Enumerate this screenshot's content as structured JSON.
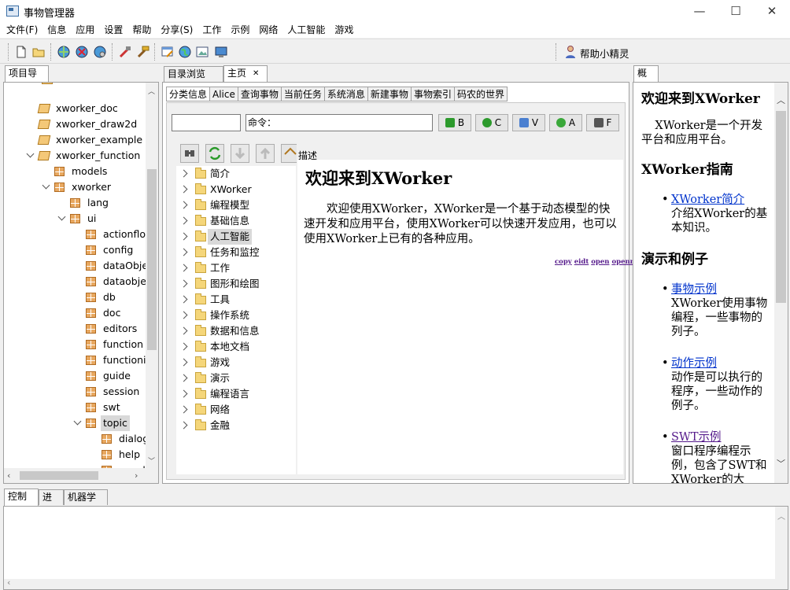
{
  "window": {
    "title": "事物管理器",
    "minimize": "—",
    "maximize": "☐",
    "close": "✕"
  },
  "menu": [
    "文件(F)",
    "信息",
    "应用",
    "设置",
    "帮助",
    "分享(S)",
    "工作",
    "示例",
    "网络",
    "人工智能",
    "游戏"
  ],
  "toolbar": {
    "helper_label": "帮助小精灵"
  },
  "left_panel": {
    "tab": "项目导航",
    "tree": [
      {
        "label": "xworker_doc",
        "type": "pkgopen"
      },
      {
        "label": "xworker_draw2d",
        "type": "pkgopen"
      },
      {
        "label": "xworker_example",
        "type": "pkgopen"
      },
      {
        "label": "xworker_function",
        "type": "pkgopen"
      },
      {
        "label": "models",
        "type": "pkg"
      },
      {
        "label": "xworker",
        "type": "pkg"
      },
      {
        "label": "lang",
        "type": "pkg"
      },
      {
        "label": "ui",
        "type": "pkg"
      },
      {
        "label": "actionflow",
        "type": "pkg"
      },
      {
        "label": "config",
        "type": "pkg"
      },
      {
        "label": "dataObje",
        "type": "pkg"
      },
      {
        "label": "dataobjec",
        "type": "pkg"
      },
      {
        "label": "db",
        "type": "pkg"
      },
      {
        "label": "doc",
        "type": "pkg"
      },
      {
        "label": "editors",
        "type": "pkg"
      },
      {
        "label": "function",
        "type": "pkg"
      },
      {
        "label": "functionin",
        "type": "pkg"
      },
      {
        "label": "guide",
        "type": "pkg"
      },
      {
        "label": "session",
        "type": "pkg"
      },
      {
        "label": "swt",
        "type": "pkg"
      },
      {
        "label": "topic",
        "type": "pkg"
      },
      {
        "label": "dialog",
        "type": "pkg"
      },
      {
        "label": "help",
        "type": "pkg"
      },
      {
        "label": "xwork",
        "type": "pkg"
      }
    ]
  },
  "center": {
    "tabs": [
      "目录浏览",
      "主页"
    ],
    "inner_tabs": [
      "分类信息",
      "Alice",
      "查询事物",
      "当前任务",
      "系统消息",
      "新建事物",
      "事物索引",
      "码农的世界"
    ],
    "search_value": "",
    "command_label": "命令：",
    "buttons": [
      {
        "label": "B",
        "color": "#2c9a2c"
      },
      {
        "label": "C",
        "color": "#2c9a2c"
      },
      {
        "label": "V",
        "color": "#4a7fd0"
      },
      {
        "label": "A",
        "color": "#3aa83a"
      },
      {
        "label": "F",
        "color": "#555555"
      }
    ],
    "categories": [
      "简介",
      "XWorker",
      "编程模型",
      "基础信息",
      "人工智能",
      "任务和监控",
      "工作",
      "图形和绘图",
      "工具",
      "操作系统",
      "数据和信息",
      "本地文档",
      "游戏",
      "演示",
      "编程语言",
      "网络",
      "金融"
    ],
    "selected_category": "人工智能",
    "desc": {
      "label": "描述",
      "heading": "欢迎来到XWorker",
      "body": "欢迎使用XWorker，XWorker是一个基于动态模型的快速开发和应用平台，使用XWorker可以快速开发应用，也可以使用XWorker上已有的各种应用。",
      "links": [
        "copy",
        "eidt",
        "open",
        "openr"
      ]
    }
  },
  "right_panel": {
    "tab": "概要",
    "h1": "欢迎来到XWorker",
    "p1": "XWorker是一个开发平台和应用平台。",
    "h2a": "XWorker指南",
    "guide": [
      {
        "link": "XWorker简介",
        "text": "介绍XWorker的基本知识。"
      }
    ],
    "h2b": "演示和例子",
    "examples": [
      {
        "link": "事物示例",
        "text": "XWorker使用事物编程，一些事物的列子。"
      },
      {
        "link": "动作示例",
        "text": "动作是可以执行的程序，一些动作的例子。"
      },
      {
        "link": "SWT示例",
        "text": "窗口程序编程示例，包含了SWT和XWorker的大"
      }
    ]
  },
  "bottom": {
    "tabs": [
      "控制台",
      "进度",
      "机器学习"
    ]
  }
}
